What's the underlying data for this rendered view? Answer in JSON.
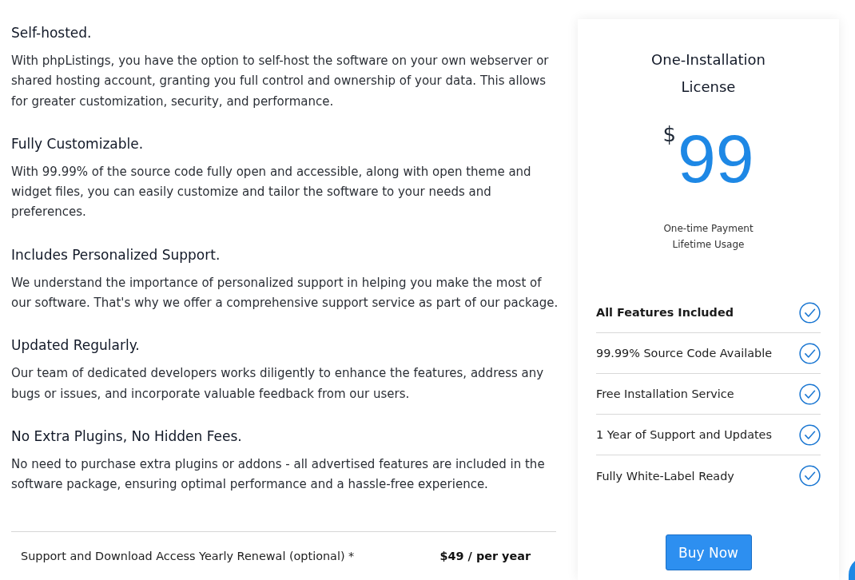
{
  "sections": [
    {
      "title": "Self-hosted.",
      "body": "With phpListings, you have the option to self-host the software on your own webserver or shared hosting account, granting you full control and ownership of your data. This allows for greater customization, security, and performance."
    },
    {
      "title": "Fully Customizable.",
      "body": "With 99.99% of the source code fully open and accessible, along with open theme and widget files, you can easily customize and tailor the software to your needs and preferences."
    },
    {
      "title": "Includes Personalized Support.",
      "body": "We understand the importance of personalized support in helping you make the most of our software. That's why we offer a comprehensive support service as part of our package."
    },
    {
      "title": "Updated Regularly.",
      "body": "Our team of dedicated developers works diligently to enhance the features, address any bugs or issues, and incorporate valuable feedback from our users."
    },
    {
      "title": "No Extra Plugins, No Hidden Fees.",
      "body": "No need to purchase extra plugins or addons - all advertised features are included in the software package, ensuring optimal performance and a hassle-free experience."
    }
  ],
  "renewal": {
    "label": "Support and Download Access Yearly Renewal (optional) *",
    "price": "$49 / per year"
  },
  "plan": {
    "title": "One-Installation License",
    "currency": "$",
    "amount": "99",
    "notes": [
      "One-time Payment",
      "Lifetime Usage"
    ],
    "features": [
      {
        "label": "All Features Included",
        "highlighted": true
      },
      {
        "label": "99.99% Source Code Available",
        "highlighted": false
      },
      {
        "label": "Free Installation Service",
        "highlighted": false
      },
      {
        "label": "1 Year of Support and Updates",
        "highlighted": false
      },
      {
        "label": "Fully White-Label Ready",
        "highlighted": false
      }
    ],
    "button": "Buy Now"
  }
}
